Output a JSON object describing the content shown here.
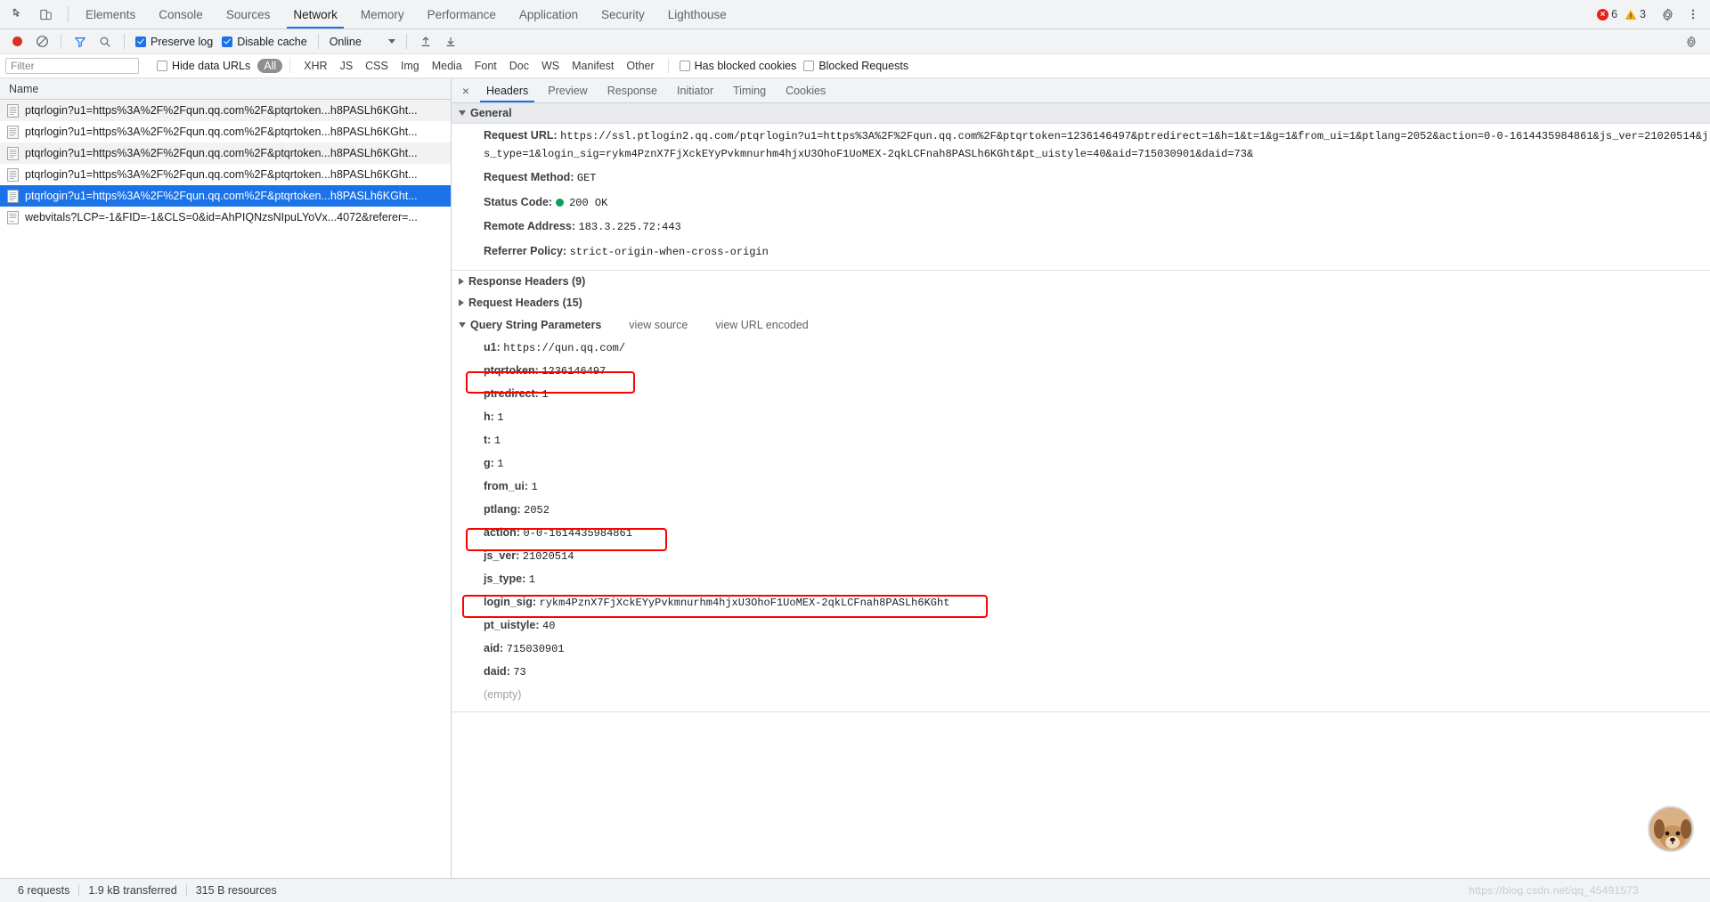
{
  "window": {
    "tabs": [
      {
        "label": "Elements",
        "active": false
      },
      {
        "label": "Console",
        "active": false
      },
      {
        "label": "Sources",
        "active": false
      },
      {
        "label": "Network",
        "active": true
      },
      {
        "label": "Memory",
        "active": false
      },
      {
        "label": "Performance",
        "active": false
      },
      {
        "label": "Application",
        "active": false
      },
      {
        "label": "Security",
        "active": false
      },
      {
        "label": "Lighthouse",
        "active": false
      }
    ],
    "error_count": "6",
    "warning_count": "3",
    "error_color": "#e62117",
    "warning_color": "#f9ab00",
    "accent_color": "#1a73e8"
  },
  "network_toolbar": {
    "record_tooltip": "Record",
    "clear_tooltip": "Clear",
    "preserve_log_label": "Preserve log",
    "preserve_log_checked": true,
    "disable_cache_label": "Disable cache",
    "disable_cache_checked": true,
    "throttle_value": "Online"
  },
  "filter_bar": {
    "filter_placeholder": "Filter",
    "filter_value": "",
    "hide_data_urls_label": "Hide data URLs",
    "hide_data_urls_checked": false,
    "types": [
      {
        "label": "All",
        "selected": true
      },
      {
        "label": "XHR",
        "selected": false
      },
      {
        "label": "JS",
        "selected": false
      },
      {
        "label": "CSS",
        "selected": false
      },
      {
        "label": "Img",
        "selected": false
      },
      {
        "label": "Media",
        "selected": false
      },
      {
        "label": "Font",
        "selected": false
      },
      {
        "label": "Doc",
        "selected": false
      },
      {
        "label": "WS",
        "selected": false
      },
      {
        "label": "Manifest",
        "selected": false
      },
      {
        "label": "Other",
        "selected": false
      }
    ],
    "has_blocked_cookies_label": "Has blocked cookies",
    "has_blocked_cookies_checked": false,
    "blocked_requests_label": "Blocked Requests",
    "blocked_requests_checked": false
  },
  "request_list": {
    "column_header": "Name",
    "rows": [
      {
        "name": "ptqrlogin?u1=https%3A%2F%2Fqun.qq.com%2F&ptqrtoken...h8PASLh6KGht...",
        "selected": false
      },
      {
        "name": "ptqrlogin?u1=https%3A%2F%2Fqun.qq.com%2F&ptqrtoken...h8PASLh6KGht...",
        "selected": false
      },
      {
        "name": "ptqrlogin?u1=https%3A%2F%2Fqun.qq.com%2F&ptqrtoken...h8PASLh6KGht...",
        "selected": false
      },
      {
        "name": "ptqrlogin?u1=https%3A%2F%2Fqun.qq.com%2F&ptqrtoken...h8PASLh6KGht...",
        "selected": false
      },
      {
        "name": "ptqrlogin?u1=https%3A%2F%2Fqun.qq.com%2F&ptqrtoken...h8PASLh6KGht...",
        "selected": true
      },
      {
        "name": "webvitals?LCP=-1&FID=-1&CLS=0&id=AhPIQNzsNIpuLYoVx...4072&referer=...",
        "selected": false
      }
    ]
  },
  "detail_tabs": [
    {
      "label": "Headers",
      "active": true
    },
    {
      "label": "Preview",
      "active": false
    },
    {
      "label": "Response",
      "active": false
    },
    {
      "label": "Initiator",
      "active": false
    },
    {
      "label": "Timing",
      "active": false
    },
    {
      "label": "Cookies",
      "active": false
    }
  ],
  "general": {
    "section_title": "General",
    "request_url_label": "Request URL:",
    "request_url_value": "https://ssl.ptlogin2.qq.com/ptqrlogin?u1=https%3A%2F%2Fqun.qq.com%2F&ptqrtoken=1236146497&ptredirect=1&h=1&t=1&g=1&from_ui=1&ptlang=2052&action=0-0-1614435984861&js_ver=21020514&js_type=1&login_sig=rykm4PznX7FjXckEYyPvkmnurhm4hjxU3OhoF1UoMEX-2qkLCFnah8PASLh6KGht&pt_uistyle=40&aid=715030901&daid=73&",
    "request_method_label": "Request Method:",
    "request_method_value": "GET",
    "status_code_label": "Status Code:",
    "status_code_value": "200 OK",
    "status_color": "#0f9d58",
    "remote_address_label": "Remote Address:",
    "remote_address_value": "183.3.225.72:443",
    "referrer_policy_label": "Referrer Policy:",
    "referrer_policy_value": "strict-origin-when-cross-origin"
  },
  "collapsed_sections": [
    {
      "title": "Response Headers (9)"
    },
    {
      "title": "Request Headers (15)"
    }
  ],
  "query_string": {
    "title": "Query String Parameters",
    "view_source_label": "view source",
    "view_url_encoded_label": "view URL encoded",
    "empty_label": "(empty)",
    "highlight_color": "#ff0000",
    "params": [
      {
        "key": "u1:",
        "value": "https://qun.qq.com/",
        "highlighted": false
      },
      {
        "key": "ptqrtoken:",
        "value": "1236146497",
        "highlighted": true
      },
      {
        "key": "ptredirect:",
        "value": "1",
        "highlighted": false
      },
      {
        "key": "h:",
        "value": "1",
        "highlighted": false
      },
      {
        "key": "t:",
        "value": "1",
        "highlighted": false
      },
      {
        "key": "g:",
        "value": "1",
        "highlighted": false
      },
      {
        "key": "from_ui:",
        "value": "1",
        "highlighted": false
      },
      {
        "key": "ptlang:",
        "value": "2052",
        "highlighted": false
      },
      {
        "key": "action:",
        "value": "0-0-1614435984861",
        "highlighted": true
      },
      {
        "key": "js_ver:",
        "value": "21020514",
        "highlighted": false
      },
      {
        "key": "js_type:",
        "value": "1",
        "highlighted": false
      },
      {
        "key": "login_sig:",
        "value": "rykm4PznX7FjXckEYyPvkmnurhm4hjxU3OhoF1UoMEX-2qkLCFnah8PASLh6KGht",
        "highlighted": true
      },
      {
        "key": "pt_uistyle:",
        "value": "40",
        "highlighted": false
      },
      {
        "key": "aid:",
        "value": "715030901",
        "highlighted": false
      },
      {
        "key": "daid:",
        "value": "73",
        "highlighted": false
      }
    ]
  },
  "status_bar": {
    "requests": "6 requests",
    "transferred": "1.9 kB transferred",
    "resources": "315 B resources"
  },
  "watermark": "https://blog.csdn.net/qq_45491573"
}
